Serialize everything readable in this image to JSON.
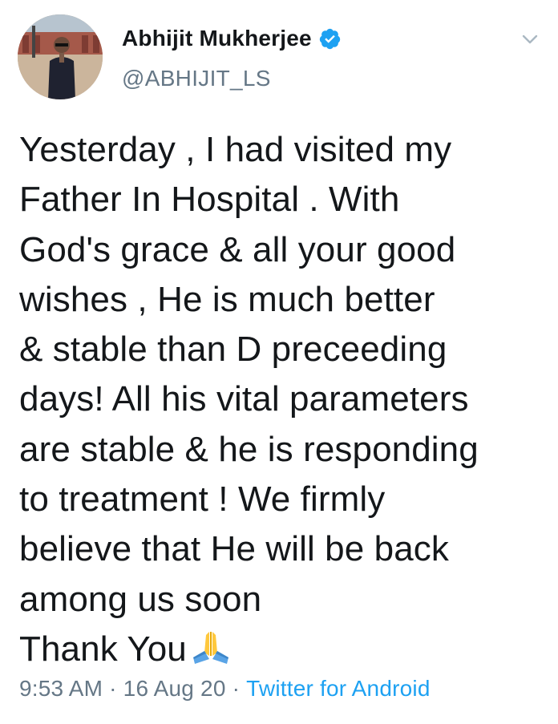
{
  "tweet": {
    "author": {
      "display_name": "Abhijit Mukherjee",
      "handle": "@ABHIJIT_LS",
      "verified": true,
      "avatar_icon": "profile-photo-icon"
    },
    "menu_icon": "chevron-down-icon",
    "text_lines": [
      "Yesterday , I had visited my",
      "Father In Hospital . With",
      "God's grace & all your good",
      "wishes , He is much better",
      "& stable than D preceeding",
      "days! All his vital parameters",
      "are stable & he is responding",
      "to treatment ! We firmly",
      "believe that He will be back",
      "among us soon",
      "Thank You"
    ],
    "trailing_emoji": "folded-hands-emoji",
    "time": "9:53 AM",
    "separator": "·",
    "date": "16 Aug 20",
    "source": "Twitter for Android"
  },
  "colors": {
    "text": "#14171a",
    "secondary": "#657786",
    "link": "#1da1f2",
    "verified": "#1da1f2"
  }
}
